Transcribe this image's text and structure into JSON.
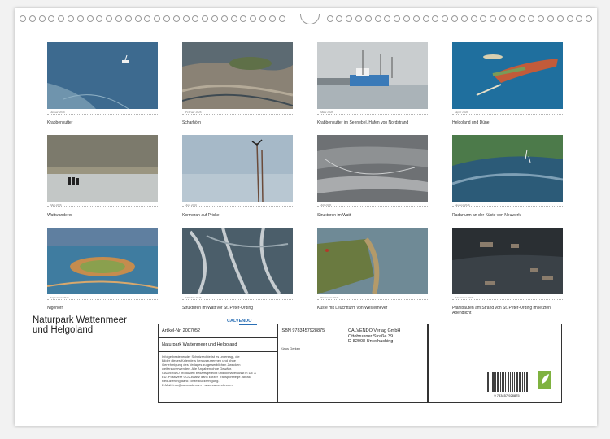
{
  "photos": [
    {
      "caption": "Krabbenkutter",
      "month": "Januar 2026"
    },
    {
      "caption": "Scharhörn",
      "month": "Februar 2026"
    },
    {
      "caption": "Krabbenkutter im Seenebel, Hafen von Nordstrand",
      "month": "März 2026"
    },
    {
      "caption": "Helgoland und Düne",
      "month": "April 2026"
    },
    {
      "caption": "Wattwanderer",
      "month": "Mai 2026"
    },
    {
      "caption": "Kormoran auf Pricke",
      "month": "Juni 2026"
    },
    {
      "caption": "Strukturen im Watt",
      "month": "Juli 2026"
    },
    {
      "caption": "Radarturm an der Küste von Neuwerk",
      "month": "August 2026"
    },
    {
      "caption": "Nigehörn",
      "month": "September 2026"
    },
    {
      "caption": "Strukturen im Watt vor St. Peter-Ording",
      "month": "Oktober 2026"
    },
    {
      "caption": "Küste mit Leuchtturm von Westerhever",
      "month": "November 2026"
    },
    {
      "caption": "Pfahlbauten am Strand von St. Peter-Ording im letzten Abendlicht",
      "month": "Dezember 2026"
    }
  ],
  "cover": {
    "title_line1": "Naturpark Wattenmeer",
    "title_line2": "und Helgoland",
    "article": "Artikel-Nr. 2007052",
    "product_title": "Naturpark Wattenmeer und Helgoland",
    "author": "Klaus Gerken",
    "isbn": "ISBN 9783457928875",
    "publisher_line1": "CALVENDO Verlag GmbH",
    "publisher_line2": "Ottobrunner Straße 39",
    "publisher_line3": "D-82008 Unterhaching",
    "logo_text": "CALVENDO",
    "legal_1": "Infolge bestehender Schutzrechte ist es untersagt, die",
    "legal_2": "Bilder dieses Kalenders herauszutrennen und ohne",
    "legal_3": "Genehmigung des Verlages zu gewerblichen Zwecken",
    "legal_4": "weiterzuverwenden. Alle Angaben ohne Gewähr.",
    "legal_5": "CALVENDO produziert bedarfsgerecht und klimabewusst in DE &",
    "legal_6": "EU. Positivere CO2-Bilanz dank kurzer Transportwege. Abfall-",
    "legal_7": "Reduzierung dank Einzelstückfertigung.",
    "legal_8": "E-Mail: info@calvendo.com • www.calvendo.com",
    "barcode_number": "9 783457 928875"
  }
}
